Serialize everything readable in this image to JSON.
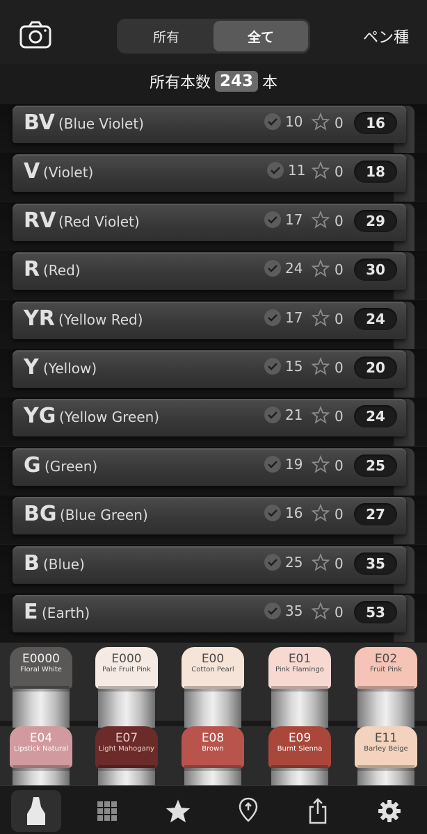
{
  "header": {
    "segments": [
      "所有",
      "全て"
    ],
    "active_segment": "全て",
    "pen_type_label": "ペン種",
    "camera_icon": "camera-icon"
  },
  "summary": {
    "prefix": "所有本数",
    "count": "243",
    "suffix": "本"
  },
  "categories": [
    {
      "code": "BV",
      "name": "(Blue Violet)",
      "owned": "10",
      "favorites": "0",
      "total": "16"
    },
    {
      "code": "V",
      "name": "(Violet)",
      "owned": "11",
      "favorites": "0",
      "total": "18"
    },
    {
      "code": "RV",
      "name": "(Red Violet)",
      "owned": "17",
      "favorites": "0",
      "total": "29"
    },
    {
      "code": "R",
      "name": "(Red)",
      "owned": "24",
      "favorites": "0",
      "total": "30"
    },
    {
      "code": "YR",
      "name": "(Yellow Red)",
      "owned": "17",
      "favorites": "0",
      "total": "24"
    },
    {
      "code": "Y",
      "name": "(Yellow)",
      "owned": "15",
      "favorites": "0",
      "total": "20"
    },
    {
      "code": "YG",
      "name": "(Yellow Green)",
      "owned": "21",
      "favorites": "0",
      "total": "24"
    },
    {
      "code": "G",
      "name": "(Green)",
      "owned": "19",
      "favorites": "0",
      "total": "25"
    },
    {
      "code": "BG",
      "name": "(Blue Green)",
      "owned": "16",
      "favorites": "0",
      "total": "27"
    },
    {
      "code": "B",
      "name": "(Blue)",
      "owned": "25",
      "favorites": "0",
      "total": "35"
    },
    {
      "code": "E",
      "name": "(Earth)",
      "owned": "35",
      "favorites": "0",
      "total": "53"
    }
  ],
  "markers_row1": [
    {
      "code": "E0000",
      "name": "Floral White",
      "cap_color": "#5a5757",
      "text_color": "#f2f2f2"
    },
    {
      "code": "E000",
      "name": "Pale Fruit Pink",
      "cap_color": "#f6ebe4",
      "text_color": "#4a4a4a"
    },
    {
      "code": "E00",
      "name": "Cotton Pearl",
      "cap_color": "#f7e4d8",
      "text_color": "#4a4a4a"
    },
    {
      "code": "E01",
      "name": "Pink Flamingo",
      "cap_color": "#f8d9d2",
      "text_color": "#4a4a4a"
    },
    {
      "code": "E02",
      "name": "Fruit Pink",
      "cap_color": "#f5c4b6",
      "text_color": "#4a4a4a"
    }
  ],
  "markers_row2": [
    {
      "code": "E04",
      "name": "Lipstick Natural",
      "cap_color": "#d19a9e",
      "text_color": "#ffffff"
    },
    {
      "code": "E07",
      "name": "Light Mahogany",
      "cap_color": "#6b2b28",
      "text_color": "#e8cfcd"
    },
    {
      "code": "E08",
      "name": "Brown",
      "cap_color": "#b8544c",
      "text_color": "#ffffff"
    },
    {
      "code": "E09",
      "name": "Burnt Sienna",
      "cap_color": "#a9473b",
      "text_color": "#ffffff"
    },
    {
      "code": "E11",
      "name": "Barley Beige",
      "cap_color": "#f3d3bd",
      "text_color": "#4a4a4a"
    }
  ],
  "tabbar": {
    "items": [
      "marker-icon",
      "swatch-grid-icon",
      "star-icon",
      "location-pin-icon",
      "share-icon",
      "gear-icon"
    ],
    "active": "marker-icon"
  }
}
